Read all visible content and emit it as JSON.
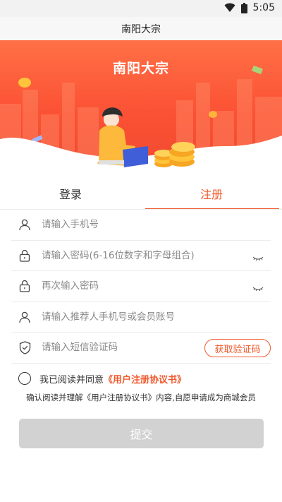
{
  "status_bar": {
    "time": "5:05",
    "icons": [
      "wifi-icon",
      "battery-icon"
    ]
  },
  "app_bar": {
    "title": "南阳大宗"
  },
  "banner": {
    "title": "南阳大宗"
  },
  "tabs": [
    {
      "label": "登录",
      "active": false
    },
    {
      "label": "注册",
      "active": true
    }
  ],
  "form": {
    "phone": {
      "placeholder": "请输入手机号",
      "icon": "user-icon"
    },
    "password": {
      "placeholder": "请输入密码(6-16位数字和字母组合)",
      "icon": "lock-icon"
    },
    "password_confirm": {
      "placeholder": "再次输入密码",
      "icon": "lock-icon"
    },
    "referrer": {
      "placeholder": "请输入推荐人手机号或会员账号",
      "icon": "user-icon"
    },
    "sms_code": {
      "placeholder": "请输入短信验证码",
      "icon": "shield-check-icon",
      "button_label": "获取验证码"
    }
  },
  "agreement": {
    "prefix": "我已阅读并同意",
    "link": "《用户注册协议书》",
    "confirm_text": "确认阅读并理解《用户注册协议书》内容,自愿申请成为商城会员"
  },
  "submit": {
    "label": "提交"
  },
  "colors": {
    "accent": "#f05a2d",
    "banner": "#fb5134",
    "disabled_button": "#d2d2d2"
  }
}
